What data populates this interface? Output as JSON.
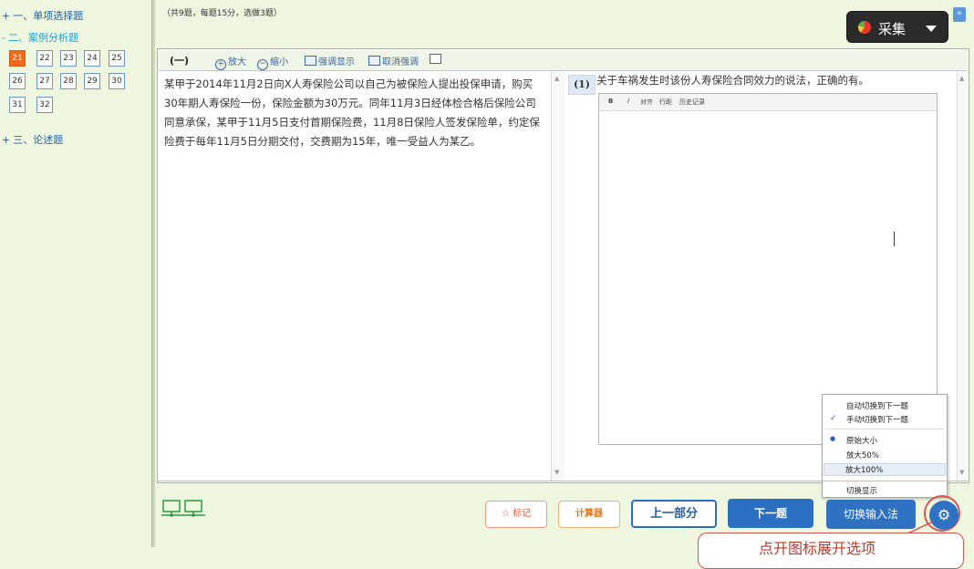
{
  "sidebar": {
    "sections": [
      {
        "prefix": "+",
        "label": "一、单项选择题"
      },
      {
        "prefix": "-",
        "label": "二、案例分析题"
      },
      {
        "prefix": "+",
        "label": "三、论述题"
      }
    ],
    "question_numbers": [
      "21",
      "22",
      "23",
      "24",
      "25",
      "26",
      "27",
      "28",
      "29",
      "30",
      "31",
      "32"
    ],
    "current_question": "21"
  },
  "header": {
    "info": "（共9题，每题15分，选做3题）",
    "collect_label": "采集",
    "collapse_glyph": "»"
  },
  "toolbar": {
    "section_label": "(一)",
    "zoom_in": "放大",
    "zoom_out": "缩小",
    "highlight": "强调显示",
    "unhighlight": "取消强调"
  },
  "passage": {
    "text": "某甲于2014年11月2日向X人寿保险公司以自己为被保险人提出投保申请，购买30年期人寿保险一份，保险金额为30万元。同年11月3日经体检合格后保险公司同意承保，某甲于11月5日支付首期保险费，11月8日保险人签发保险单，约定保险费于每年11月5日分期交付，交费期为15年，唯一受益人为某乙。"
  },
  "question": {
    "number": "(1)",
    "text": "关于车祸发生时该份人寿保险合同效力的说法，正确的有。"
  },
  "editor": {
    "bold": "B",
    "italic": "I",
    "align": "对齐",
    "line": "行距",
    "history": "历史记录"
  },
  "options_menu": {
    "items": [
      {
        "label": "自动切换到下一题",
        "mark": ""
      },
      {
        "label": "手动切换到下一题",
        "mark": "✓"
      },
      {
        "label": "原始大小",
        "mark": "●"
      },
      {
        "label": "放大50%",
        "mark": ""
      },
      {
        "label": "放大100%",
        "mark": ""
      },
      {
        "label": "切换显示",
        "mark": ""
      }
    ]
  },
  "buttons": {
    "mark": "☆ 标记",
    "calc": "计算器",
    "prev": "上一部分",
    "next": "下一题",
    "ime": "切换输入法",
    "settings_icon": "gear-icon"
  },
  "callout": {
    "text": "点开图标展开选项"
  },
  "colors": {
    "accent": "#2b6fc1",
    "current_question": "#ee6a1d",
    "callout": "#d9534f",
    "background": "#eef6df"
  }
}
